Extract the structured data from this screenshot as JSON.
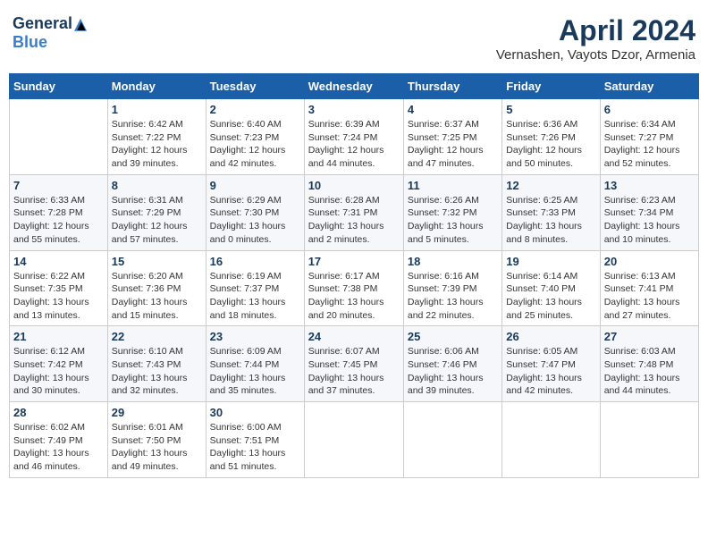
{
  "logo": {
    "general": "General",
    "blue": "Blue"
  },
  "title": "April 2024",
  "subtitle": "Vernashen, Vayots Dzor, Armenia",
  "days_header": [
    "Sunday",
    "Monday",
    "Tuesday",
    "Wednesday",
    "Thursday",
    "Friday",
    "Saturday"
  ],
  "weeks": [
    [
      {
        "num": "",
        "sunrise": "",
        "sunset": "",
        "daylight": ""
      },
      {
        "num": "1",
        "sunrise": "Sunrise: 6:42 AM",
        "sunset": "Sunset: 7:22 PM",
        "daylight": "Daylight: 12 hours and 39 minutes."
      },
      {
        "num": "2",
        "sunrise": "Sunrise: 6:40 AM",
        "sunset": "Sunset: 7:23 PM",
        "daylight": "Daylight: 12 hours and 42 minutes."
      },
      {
        "num": "3",
        "sunrise": "Sunrise: 6:39 AM",
        "sunset": "Sunset: 7:24 PM",
        "daylight": "Daylight: 12 hours and 44 minutes."
      },
      {
        "num": "4",
        "sunrise": "Sunrise: 6:37 AM",
        "sunset": "Sunset: 7:25 PM",
        "daylight": "Daylight: 12 hours and 47 minutes."
      },
      {
        "num": "5",
        "sunrise": "Sunrise: 6:36 AM",
        "sunset": "Sunset: 7:26 PM",
        "daylight": "Daylight: 12 hours and 50 minutes."
      },
      {
        "num": "6",
        "sunrise": "Sunrise: 6:34 AM",
        "sunset": "Sunset: 7:27 PM",
        "daylight": "Daylight: 12 hours and 52 minutes."
      }
    ],
    [
      {
        "num": "7",
        "sunrise": "Sunrise: 6:33 AM",
        "sunset": "Sunset: 7:28 PM",
        "daylight": "Daylight: 12 hours and 55 minutes."
      },
      {
        "num": "8",
        "sunrise": "Sunrise: 6:31 AM",
        "sunset": "Sunset: 7:29 PM",
        "daylight": "Daylight: 12 hours and 57 minutes."
      },
      {
        "num": "9",
        "sunrise": "Sunrise: 6:29 AM",
        "sunset": "Sunset: 7:30 PM",
        "daylight": "Daylight: 13 hours and 0 minutes."
      },
      {
        "num": "10",
        "sunrise": "Sunrise: 6:28 AM",
        "sunset": "Sunset: 7:31 PM",
        "daylight": "Daylight: 13 hours and 2 minutes."
      },
      {
        "num": "11",
        "sunrise": "Sunrise: 6:26 AM",
        "sunset": "Sunset: 7:32 PM",
        "daylight": "Daylight: 13 hours and 5 minutes."
      },
      {
        "num": "12",
        "sunrise": "Sunrise: 6:25 AM",
        "sunset": "Sunset: 7:33 PM",
        "daylight": "Daylight: 13 hours and 8 minutes."
      },
      {
        "num": "13",
        "sunrise": "Sunrise: 6:23 AM",
        "sunset": "Sunset: 7:34 PM",
        "daylight": "Daylight: 13 hours and 10 minutes."
      }
    ],
    [
      {
        "num": "14",
        "sunrise": "Sunrise: 6:22 AM",
        "sunset": "Sunset: 7:35 PM",
        "daylight": "Daylight: 13 hours and 13 minutes."
      },
      {
        "num": "15",
        "sunrise": "Sunrise: 6:20 AM",
        "sunset": "Sunset: 7:36 PM",
        "daylight": "Daylight: 13 hours and 15 minutes."
      },
      {
        "num": "16",
        "sunrise": "Sunrise: 6:19 AM",
        "sunset": "Sunset: 7:37 PM",
        "daylight": "Daylight: 13 hours and 18 minutes."
      },
      {
        "num": "17",
        "sunrise": "Sunrise: 6:17 AM",
        "sunset": "Sunset: 7:38 PM",
        "daylight": "Daylight: 13 hours and 20 minutes."
      },
      {
        "num": "18",
        "sunrise": "Sunrise: 6:16 AM",
        "sunset": "Sunset: 7:39 PM",
        "daylight": "Daylight: 13 hours and 22 minutes."
      },
      {
        "num": "19",
        "sunrise": "Sunrise: 6:14 AM",
        "sunset": "Sunset: 7:40 PM",
        "daylight": "Daylight: 13 hours and 25 minutes."
      },
      {
        "num": "20",
        "sunrise": "Sunrise: 6:13 AM",
        "sunset": "Sunset: 7:41 PM",
        "daylight": "Daylight: 13 hours and 27 minutes."
      }
    ],
    [
      {
        "num": "21",
        "sunrise": "Sunrise: 6:12 AM",
        "sunset": "Sunset: 7:42 PM",
        "daylight": "Daylight: 13 hours and 30 minutes."
      },
      {
        "num": "22",
        "sunrise": "Sunrise: 6:10 AM",
        "sunset": "Sunset: 7:43 PM",
        "daylight": "Daylight: 13 hours and 32 minutes."
      },
      {
        "num": "23",
        "sunrise": "Sunrise: 6:09 AM",
        "sunset": "Sunset: 7:44 PM",
        "daylight": "Daylight: 13 hours and 35 minutes."
      },
      {
        "num": "24",
        "sunrise": "Sunrise: 6:07 AM",
        "sunset": "Sunset: 7:45 PM",
        "daylight": "Daylight: 13 hours and 37 minutes."
      },
      {
        "num": "25",
        "sunrise": "Sunrise: 6:06 AM",
        "sunset": "Sunset: 7:46 PM",
        "daylight": "Daylight: 13 hours and 39 minutes."
      },
      {
        "num": "26",
        "sunrise": "Sunrise: 6:05 AM",
        "sunset": "Sunset: 7:47 PM",
        "daylight": "Daylight: 13 hours and 42 minutes."
      },
      {
        "num": "27",
        "sunrise": "Sunrise: 6:03 AM",
        "sunset": "Sunset: 7:48 PM",
        "daylight": "Daylight: 13 hours and 44 minutes."
      }
    ],
    [
      {
        "num": "28",
        "sunrise": "Sunrise: 6:02 AM",
        "sunset": "Sunset: 7:49 PM",
        "daylight": "Daylight: 13 hours and 46 minutes."
      },
      {
        "num": "29",
        "sunrise": "Sunrise: 6:01 AM",
        "sunset": "Sunset: 7:50 PM",
        "daylight": "Daylight: 13 hours and 49 minutes."
      },
      {
        "num": "30",
        "sunrise": "Sunrise: 6:00 AM",
        "sunset": "Sunset: 7:51 PM",
        "daylight": "Daylight: 13 hours and 51 minutes."
      },
      {
        "num": "",
        "sunrise": "",
        "sunset": "",
        "daylight": ""
      },
      {
        "num": "",
        "sunrise": "",
        "sunset": "",
        "daylight": ""
      },
      {
        "num": "",
        "sunrise": "",
        "sunset": "",
        "daylight": ""
      },
      {
        "num": "",
        "sunrise": "",
        "sunset": "",
        "daylight": ""
      }
    ]
  ]
}
